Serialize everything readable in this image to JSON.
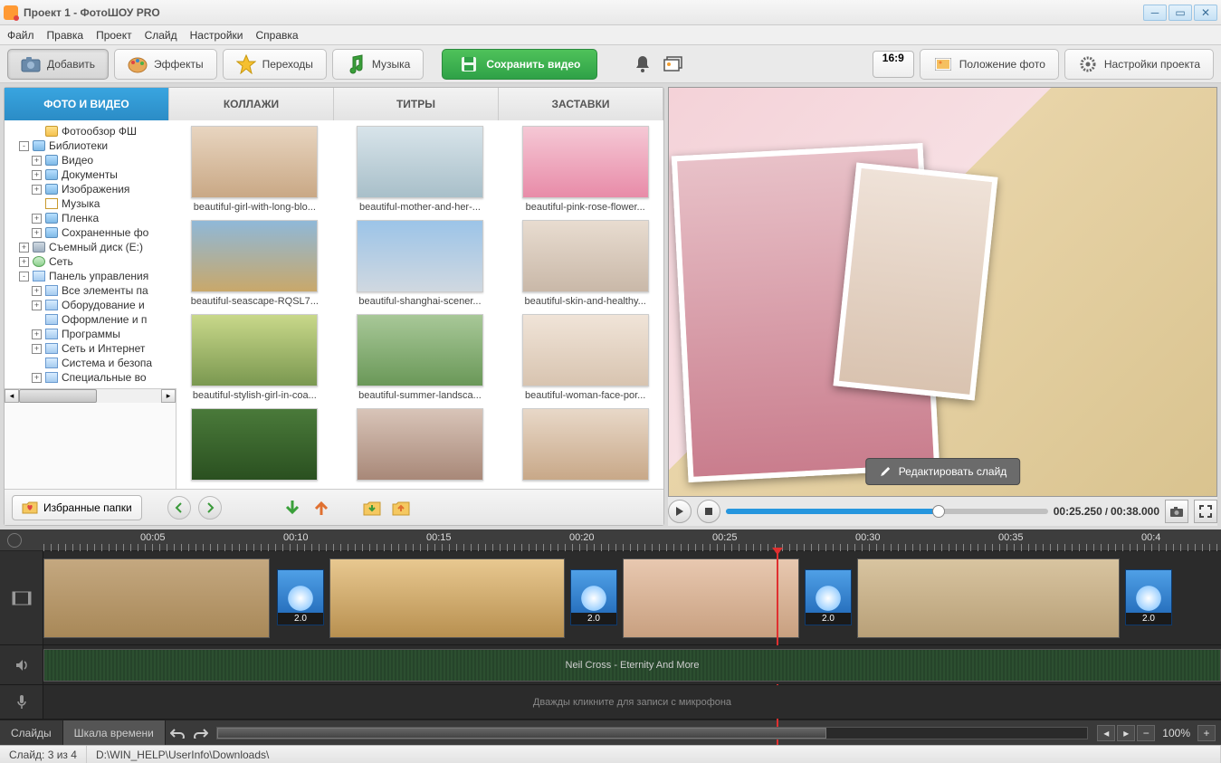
{
  "window": {
    "title": "Проект 1 - ФотоШОУ PRO"
  },
  "menu": [
    "Файл",
    "Правка",
    "Проект",
    "Слайд",
    "Настройки",
    "Справка"
  ],
  "toolbar": {
    "add": "Добавить",
    "effects": "Эффекты",
    "transitions": "Переходы",
    "music": "Музыка",
    "save": "Сохранить видео",
    "aspect": "16:9",
    "position": "Положение фото",
    "settings": "Настройки проекта"
  },
  "tabs": {
    "photo": "ФОТО И ВИДЕО",
    "collage": "КОЛЛАЖИ",
    "titles": "ТИТРЫ",
    "intros": "ЗАСТАВКИ"
  },
  "tree": [
    {
      "lvl": 2,
      "exp": "",
      "ico": "folder",
      "label": "Фотообзор ФШ"
    },
    {
      "lvl": 1,
      "exp": "-",
      "ico": "lib",
      "label": "Библиотеки"
    },
    {
      "lvl": 2,
      "exp": "+",
      "ico": "lib",
      "label": "Видео"
    },
    {
      "lvl": 2,
      "exp": "+",
      "ico": "lib",
      "label": "Документы"
    },
    {
      "lvl": 2,
      "exp": "+",
      "ico": "lib",
      "label": "Изображения"
    },
    {
      "lvl": 2,
      "exp": "",
      "ico": "music",
      "label": "Музыка"
    },
    {
      "lvl": 2,
      "exp": "+",
      "ico": "lib",
      "label": "Пленка"
    },
    {
      "lvl": 2,
      "exp": "+",
      "ico": "lib",
      "label": "Сохраненные фо"
    },
    {
      "lvl": 1,
      "exp": "+",
      "ico": "drive",
      "label": "Съемный диск (E:)"
    },
    {
      "lvl": 1,
      "exp": "+",
      "ico": "net",
      "label": "Сеть"
    },
    {
      "lvl": 1,
      "exp": "-",
      "ico": "cp",
      "label": "Панель управления"
    },
    {
      "lvl": 2,
      "exp": "+",
      "ico": "cp",
      "label": "Все элементы па"
    },
    {
      "lvl": 2,
      "exp": "+",
      "ico": "cp",
      "label": "Оборудование и"
    },
    {
      "lvl": 2,
      "exp": "",
      "ico": "cp",
      "label": "Оформление и п"
    },
    {
      "lvl": 2,
      "exp": "+",
      "ico": "cp",
      "label": "Программы"
    },
    {
      "lvl": 2,
      "exp": "+",
      "ico": "cp",
      "label": "Сеть и Интернет"
    },
    {
      "lvl": 2,
      "exp": "",
      "ico": "cp",
      "label": "Система и безопа"
    },
    {
      "lvl": 2,
      "exp": "+",
      "ico": "cp",
      "label": "Специальные во"
    }
  ],
  "thumbs": [
    {
      "name": "beautiful-girl-with-long-blo...",
      "bg": "linear-gradient(#e8d5c0,#c9a885)"
    },
    {
      "name": "beautiful-mother-and-her-...",
      "bg": "linear-gradient(#d8e4ea,#a8bfc9)"
    },
    {
      "name": "beautiful-pink-rose-flower...",
      "bg": "linear-gradient(#f5c8d5,#e88ba8)"
    },
    {
      "name": "beautiful-seascape-RQSL7...",
      "bg": "linear-gradient(#8fb8d8,#c9a86a)"
    },
    {
      "name": "beautiful-shanghai-scener...",
      "bg": "linear-gradient(#9cc4e8,#d0d8e0)"
    },
    {
      "name": "beautiful-skin-and-healthy...",
      "bg": "linear-gradient(#e8dcd0,#c9b8a8)"
    },
    {
      "name": "beautiful-stylish-girl-in-coa...",
      "bg": "linear-gradient(#c9d88a,#7a9850)"
    },
    {
      "name": "beautiful-summer-landsca...",
      "bg": "linear-gradient(#a8c898,#6a9858)"
    },
    {
      "name": "beautiful-woman-face-por...",
      "bg": "linear-gradient(#f0e4d8,#d8c4b0)"
    },
    {
      "name": "",
      "bg": "linear-gradient(#4a7a3a,#2a5020)"
    },
    {
      "name": "",
      "bg": "linear-gradient(#d8c4b8,#a88878)"
    },
    {
      "name": "",
      "bg": "linear-gradient(#e8d8c8,#c8a888)"
    }
  ],
  "favorites": "Избранные папки",
  "preview": {
    "edit": "Редактировать слайд",
    "time_current": "00:25.250",
    "time_total": "00:38.000"
  },
  "ruler": [
    "00:05",
    "00:10",
    "00:15",
    "00:20",
    "00:25",
    "00:30",
    "00:35",
    "00:4"
  ],
  "transitions_dur": "2.0",
  "audio": {
    "title": "Neil Cross - Eternity And More"
  },
  "mic": {
    "hint": "Дважды кликните для записи с микрофона"
  },
  "timeline_tabs": {
    "slides": "Слайды",
    "time": "Шкала времени"
  },
  "zoom": "100%",
  "status": {
    "slide": "Слайд: 3 из 4",
    "path": "D:\\WIN_HELP\\UserInfo\\Downloads\\"
  }
}
